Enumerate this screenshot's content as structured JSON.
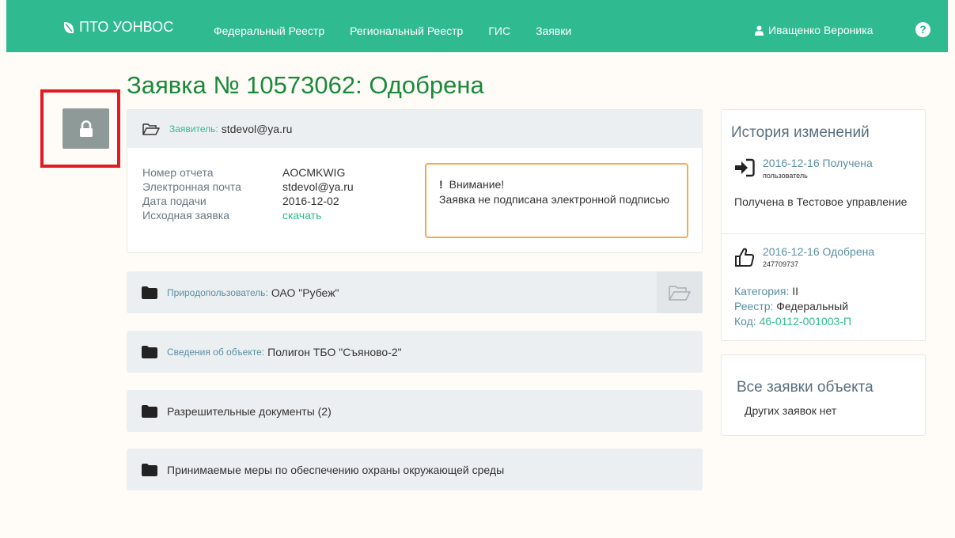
{
  "navbar": {
    "brand": "ПТО УОНВОС",
    "links": [
      "Федеральный Реестр",
      "Региональный Реестр",
      "ГИС",
      "Заявки"
    ],
    "user": "Иващенко Вероника",
    "help": "?"
  },
  "page_title": "Заявка № 10573062: Одобрена",
  "applicant": {
    "label": "Заявитель:",
    "value": "stdevol@ya.ru",
    "fields": [
      {
        "key": "Номер отчета",
        "value": "AOCMKWIG"
      },
      {
        "key": "Электронная почта",
        "value": "stdevol@ya.ru"
      },
      {
        "key": "Дата подачи",
        "value": "2016-12-02"
      },
      {
        "key": "Исходная заявка",
        "value": "скачать"
      }
    ],
    "warning": {
      "title": "Внимание!",
      "text": "Заявка не подписана электронной подписью"
    }
  },
  "sections": [
    {
      "label": "Природопользователь:",
      "value": "ОАО \"Рубеж\""
    },
    {
      "label": "Сведения об объекте:",
      "value": "Полигон ТБО \"Съяново-2\""
    },
    {
      "label": "",
      "value": "Разрешительные документы (2)"
    },
    {
      "label": "",
      "value": "Принимаемые меры по обеспечению охраны окружающей среды"
    }
  ],
  "history": {
    "title": "История изменений",
    "items": [
      {
        "date_status": "2016-12-16 Получена",
        "who": "пользователь",
        "text": "Получена в Тестовое управление",
        "icon": "sign-in-icon"
      },
      {
        "date_status": "2016-12-16 Одобрена",
        "who": "247709737",
        "icon": "thumbs-up-icon",
        "category_key": "Категория:",
        "category_value": "II",
        "registry_key": "Реестр:",
        "registry_value": "Федеральный",
        "code_key": "Код:",
        "code_value": "46-0112-001003-П"
      }
    ]
  },
  "object_requests": {
    "title": "Все заявки объекта",
    "text": "Других заявок нет"
  },
  "colors": {
    "navbar": "#2fbb8f",
    "title": "#1a8a3a",
    "warning_border": "#f0ad4e",
    "highlight": "#e21b23",
    "lock_button": "#8e9a97"
  }
}
